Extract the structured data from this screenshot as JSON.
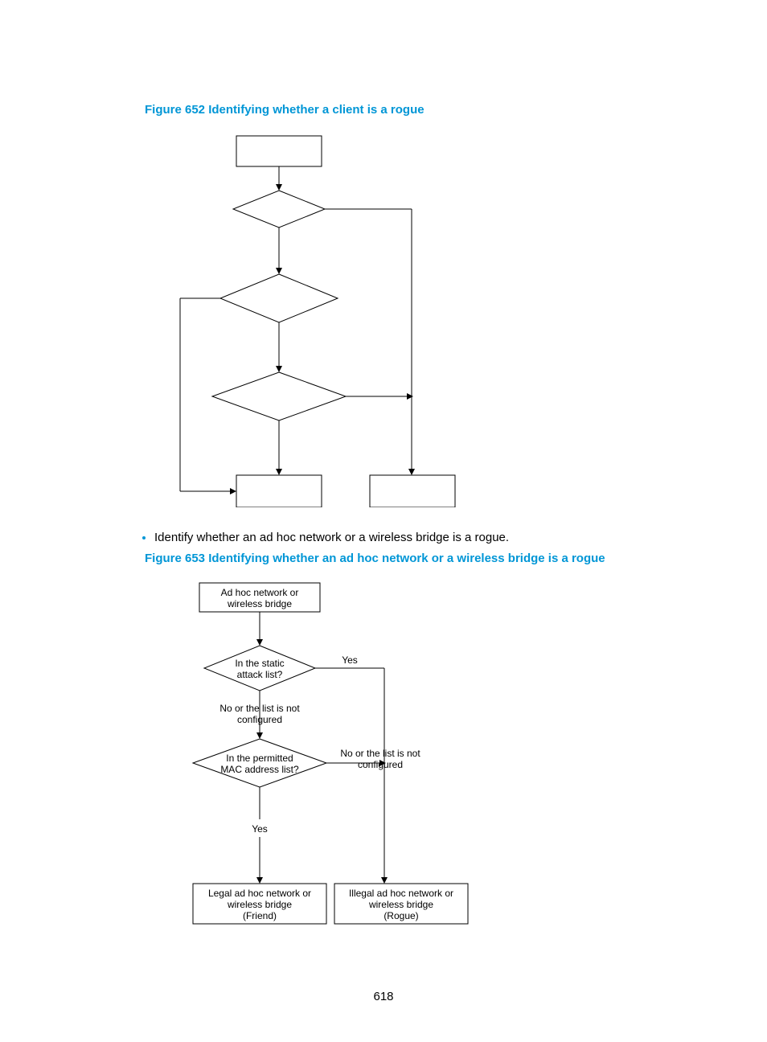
{
  "pageNumber": "618",
  "figure652": {
    "caption": "Figure 652 Identifying whether a client is a rogue"
  },
  "bullet": "Identify whether an ad hoc network or a wireless bridge is a rogue.",
  "figure653": {
    "caption": "Figure 653 Identifying whether an ad hoc network or a wireless bridge is a rogue",
    "start": [
      "Ad hoc network or",
      "wireless bridge"
    ],
    "d1": [
      "In the static",
      "attack list?"
    ],
    "d1_yes": "Yes",
    "d1_no": [
      "No or the list is not",
      "configured"
    ],
    "d2": [
      "In the permitted",
      "MAC address list?"
    ],
    "d2_yes": "Yes",
    "d2_no": [
      "No or the list is not",
      "configured"
    ],
    "resultFriend": [
      "Legal ad hoc network or",
      "wireless bridge",
      "(Friend)"
    ],
    "resultRogue": [
      "Illegal ad hoc network or",
      "wireless bridge",
      "(Rogue)"
    ]
  }
}
